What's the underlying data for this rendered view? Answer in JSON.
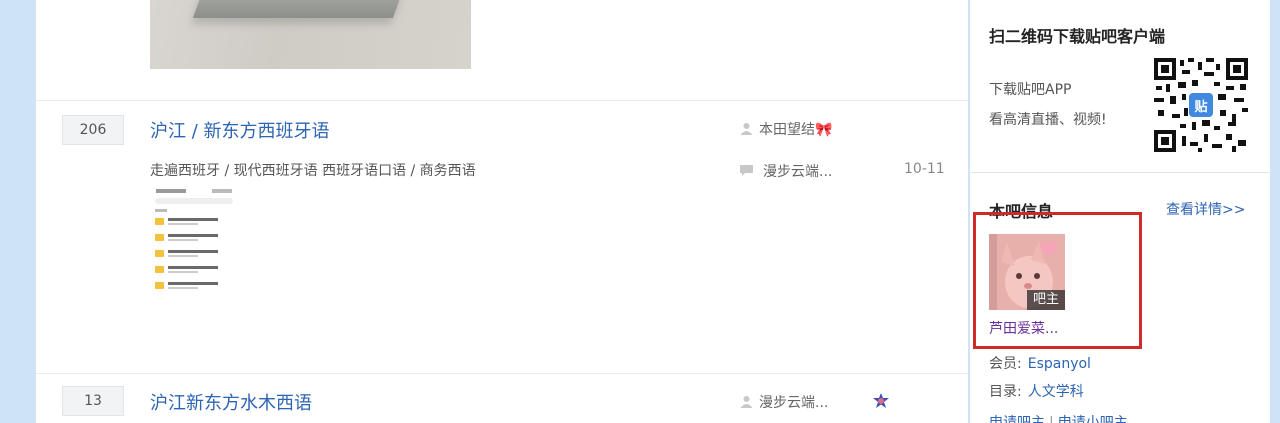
{
  "threads": [
    {
      "reply_count": "206",
      "title": "沪江 / 新东方西班牙语",
      "abstract": "走遍西班牙 / 现代西班牙语 西班牙语口语 / 商务西语",
      "author": "本田望结🎀",
      "last_reply_user": "漫步云端...",
      "last_reply_date": "10-11"
    },
    {
      "reply_count": "13",
      "title": "沪江新东方水木西语",
      "author": "漫步云端..."
    }
  ],
  "sidebar": {
    "qr": {
      "title": "扫二维码下载贴吧客户端",
      "line1": "下载贴吧APP",
      "line2": "看高清直播、视频!",
      "qr_badge": "贴"
    },
    "bar_info": {
      "title": "本吧信息",
      "more_link": "查看详情>>",
      "owner_tag": "吧主",
      "owner_name": "芦田爱菜...",
      "member_label": "会员:",
      "member_value": "Espanyol",
      "dir_label": "目录:",
      "dir_value": "人文学科",
      "apply_owner": "申请吧主",
      "apply_sep": "|",
      "apply_sub_owner": "申请小吧主"
    }
  },
  "colors": {
    "link_blue": "#2d64b3",
    "highlight_red": "#cf2a2a",
    "page_bg": "#cfe3f6"
  }
}
